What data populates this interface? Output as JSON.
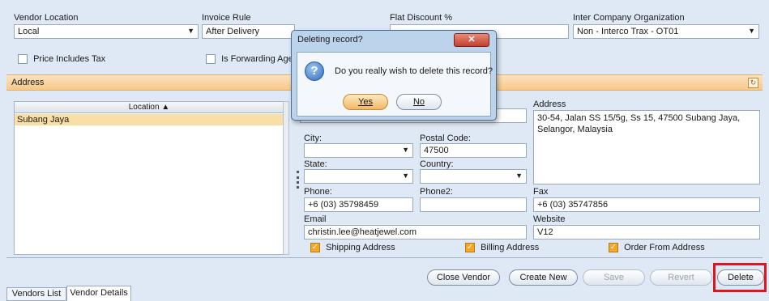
{
  "form": {
    "vendor_location_label": "Vendor Location",
    "vendor_location_value": "Local",
    "invoice_rule_label": "Invoice Rule",
    "invoice_rule_value": "After Delivery",
    "flat_discount_label": "Flat Discount %",
    "flat_discount_value": "",
    "interco_label": "Inter Company Organization",
    "interco_value": "Non - Interco Trax - OT01",
    "price_includes_tax_label": "Price Includes Tax",
    "is_forwarding_agent_label": "Is Forwarding Agen"
  },
  "address_section": {
    "title": "Address",
    "location_col_header": "Location ▲",
    "locations": [
      "Subang Jaya"
    ],
    "city_label": "City:",
    "city_value": "",
    "postal_code_label": "Postal Code:",
    "postal_code_value": "47500",
    "state_label": "State:",
    "state_value": "",
    "country_label": "Country:",
    "country_value": "",
    "phone_label": "Phone:",
    "phone_value": "+6 (03) 35798459",
    "phone2_label": "Phone2:",
    "phone2_value": "",
    "fax_label": "Fax",
    "fax_value": "+6 (03) 35747856",
    "email_label": "Email",
    "email_value": "christin.lee@heatjewel.com",
    "website_label": "Website",
    "website_value": "V12",
    "address_label": "Address",
    "address_value": "30-54, Jalan SS 15/5g, Ss 15, 47500 Subang Jaya, Selangor, Malaysia",
    "shipping_label": "Shipping Address",
    "billing_label": "Billing Address",
    "order_from_label": "Order From Address"
  },
  "dialog": {
    "title": "Deleting record?",
    "message": "Do you really wish to delete this record?",
    "yes_label": "Yes",
    "no_label": "No",
    "close_glyph": "✕"
  },
  "toolbar": {
    "close_vendor": "Close Vendor",
    "create_new": "Create New",
    "save": "Save",
    "revert": "Revert",
    "delete": "Delete"
  },
  "tabs": [
    "Vendors List",
    "Vendor Details"
  ],
  "colors": {
    "highlight_border": "#e0161b",
    "section_bar": "#f6c98a",
    "selected_row": "#f9dfa6",
    "checkbox_on": "#f5a623"
  }
}
